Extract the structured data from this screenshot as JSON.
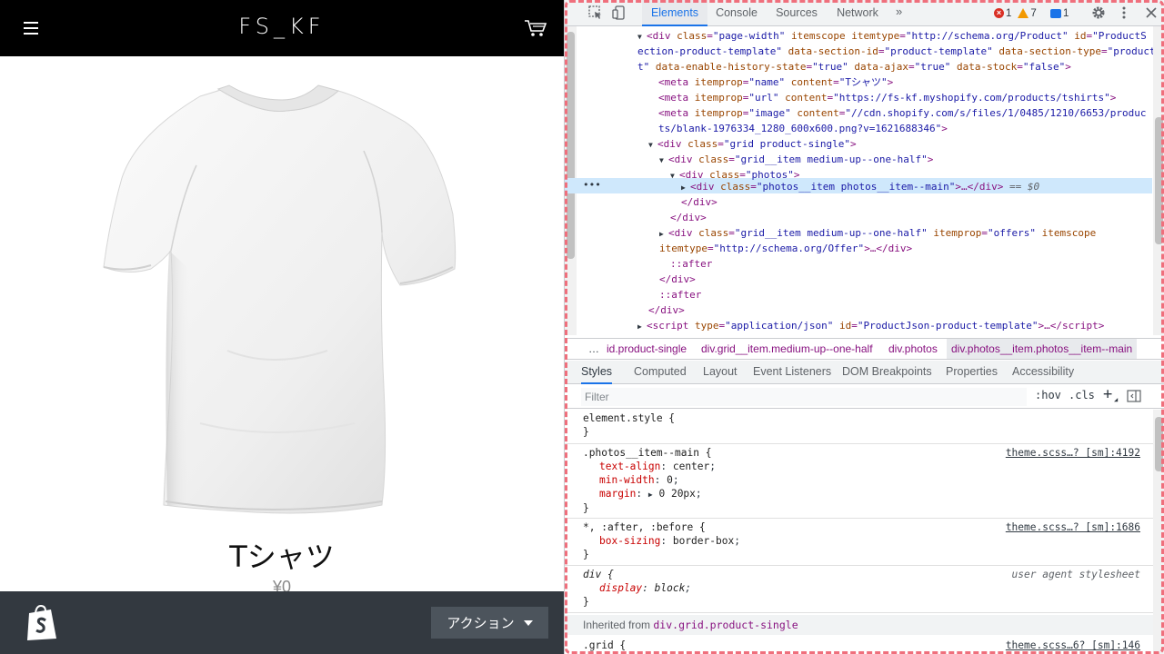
{
  "shop": {
    "logo": "FS_KF",
    "product_title": "Tシャツ",
    "product_price": "¥0",
    "action_button": "アクション",
    "icons": {
      "menu": "hamburger-menu-icon",
      "cart": "cart-icon",
      "shopify": "shopify-bag-icon"
    }
  },
  "devtools": {
    "tabs": [
      "Elements",
      "Console",
      "Sources",
      "Network"
    ],
    "active_tab": "Elements",
    "more_tabs": "»",
    "errors": "1",
    "warnings": "7",
    "messages": "1",
    "dom": {
      "l1a": "<div ",
      "l1_class_attr": "class",
      "l1_class_val": "\"page-width\"",
      "l1_itemscope": " itemscope",
      "l1_itemtype_attr": " itemtype",
      "l1_itemtype_val": "\"http://schema.org/Product\"",
      "l1_id_attr": " id",
      "l1_id_val": "\"ProductS",
      "l2": "ection-product-template\"",
      "l2_dsid_attr": " data-section-id",
      "l2_dsid_val": "\"product-template\"",
      "l2_dst_attr": " data-section-type",
      "l2_dst_val": "\"product",
      "l3": "t\"",
      "l3_eh_attr": " data-enable-history-state",
      "l3_eh_val": "\"true\"",
      "l3_da_attr": " data-ajax",
      "l3_da_val": "\"true\"",
      "l3_ds_attr": " data-stock",
      "l3_ds_val": "\"false\"",
      "l3_end": ">",
      "meta1_prop": "\"name\"",
      "meta1_content": "\"Tシャツ\"",
      "meta2_prop": "\"url\"",
      "meta2_content": "\"https://fs-kf.myshopify.com/products/tshirts\"",
      "meta3_prop": "\"image\"",
      "meta3_content_a": "\"//cdn.shopify.com/s/files/1/0485/1210/6653/produc",
      "meta3_content_b": "ts/blank-1976334_1280_600x600.png?v=1621688346\"",
      "grid_class": "\"grid product-single\"",
      "grid_item_class": "\"grid__item medium-up--one-half\"",
      "photos_class": "\"photos\"",
      "photos_item_class": "\"photos__item photos__item--main\"",
      "selected_suffix": " == $0",
      "grid_item2_class": "\"grid__item medium-up--one-half\"",
      "itemprop_val": "\"offers\"",
      "itemtype_val": "\"http://schema.org/Offer\"",
      "after": "::after",
      "script_type": "\"application/json\"",
      "script_id": "\"ProductJson-product-template\""
    },
    "breadcrumb": [
      "id.product-single",
      "div.grid__item.medium-up--one-half",
      "div.photos",
      "div.photos__item.photos__item--main"
    ],
    "sub_tabs": [
      "Styles",
      "Computed",
      "Layout",
      "Event Listeners",
      "DOM Breakpoints",
      "Properties",
      "Accessibility"
    ],
    "filter_placeholder": "Filter",
    "filter_hov": ":hov",
    "filter_cls": ".cls",
    "styles": {
      "element_style": "element.style {",
      "close": "}",
      "r1_selector": ".photos__item--main {",
      "r1_src": "theme.scss…? [sm]:4192",
      "r1_p1n": "text-align",
      "r1_p1v": "center",
      "r1_p2n": "min-width",
      "r1_p2v": "0",
      "r1_p3n": "margin",
      "r1_p3v": "0 20px",
      "r2_selector": "*, :after, :before {",
      "r2_src": "theme.scss…? [sm]:1686",
      "r2_p1n": "box-sizing",
      "r2_p1v": "border-box",
      "r3_selector": "div {",
      "r3_src": "user agent stylesheet",
      "r3_p1n": "display",
      "r3_p1v": "block",
      "inherited_label": "Inherited from ",
      "inherited_link": "div.grid.product-single",
      "r4_selector": ".grid {",
      "r4_src": "theme.scss…6? [sm]:146"
    }
  }
}
